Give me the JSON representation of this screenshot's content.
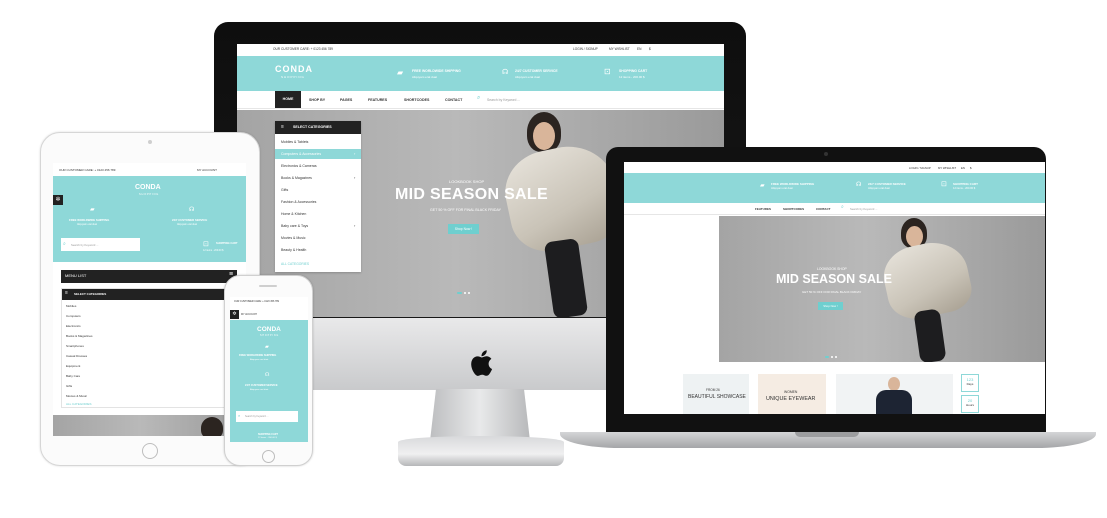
{
  "brand": {
    "name": "CONDA",
    "tagline": "SHOPPING"
  },
  "colors": {
    "accent": "#8ed8d8",
    "button": "#6fcfcf",
    "dark": "#222222"
  },
  "topbar": {
    "care": "OUR CUSTOMER CARE: + 0123 456 789",
    "login": "LOGIN / SIGNUP",
    "wishlist": "MY WISHLIST",
    "lang": "EN",
    "currency": "$",
    "account": "MY ACCOUNT"
  },
  "promos": {
    "shipping_title": "FREE WORLDWIDE SHIPPING",
    "shipping_sub": "Aliquyam erat duat",
    "service_title": "24/7 CUSTOMER SERVICE",
    "service_sub": "Aliquyam erat duat",
    "cart_title": "SHOPPING CART",
    "cart_sub": "12 items - 200.00 $"
  },
  "nav": [
    "HOME",
    "SHOP BY",
    "PAGES",
    "FEATURES",
    "SHORTCODES",
    "CONTACT"
  ],
  "search": {
    "placeholder": "Search by Keyword ..."
  },
  "categories": {
    "title": "SELECT CATEGORIES",
    "items": [
      "Mobiles & Tablets",
      "Computers & Accessories",
      "Electronics & Cameras",
      "Books & Magazines",
      "Gifts",
      "Fashion & Accessories",
      "Home & Kitchen",
      "Baby care & Toys",
      "Movies & Music",
      "Beauty & Health"
    ],
    "all": "ALL CATEGORIES"
  },
  "hero": {
    "kicker": "LOOKBOOK SHOP",
    "title": "MID SEASON SALE",
    "subtitle": "GET 50 % OFF FOR FINAL BLACK FRIDAY",
    "button": "Shop Now !"
  },
  "tablet_menu": {
    "title": "MENU LIST",
    "cat_title": "SELECT CATEGORIES",
    "items": [
      "Mobiles",
      "Computers",
      "Electronics",
      "Books & Magazines",
      "Smartphones",
      "Casual Dresses",
      "Equipment",
      "Baby Care",
      "Gifts",
      "Movies & Music"
    ],
    "all": "ALL CATEGORIES"
  },
  "laptop_cards": {
    "card1_line1": "FROM 26",
    "card1_line2": "BEAUTIFUL SHOWCASE",
    "card2_line1": "WOMEN",
    "card2_line2": "UNIQUE EYEWEAR",
    "count1": "123",
    "count1_label": "Days",
    "count2": "20",
    "count2_label": "Hours"
  }
}
